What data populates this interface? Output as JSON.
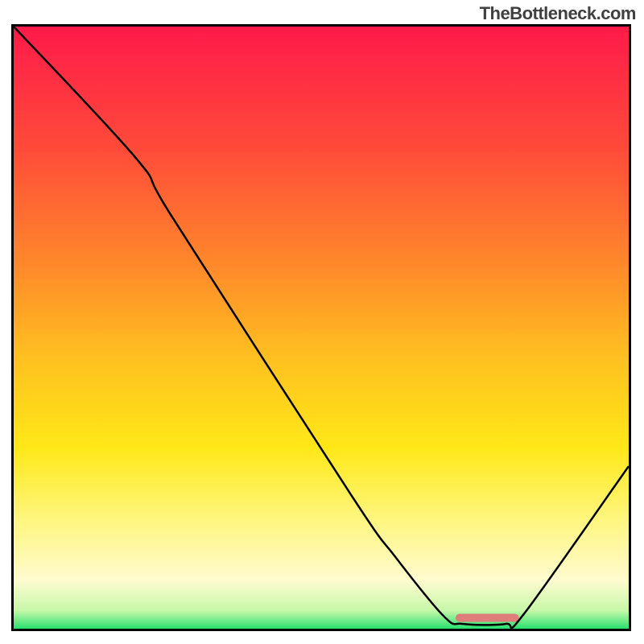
{
  "watermark": "TheBottleneck.com",
  "chart_data": {
    "type": "line",
    "title": "",
    "xlabel": "",
    "ylabel": "",
    "xlim": [
      0,
      100
    ],
    "ylim": [
      0,
      100
    ],
    "grid": false,
    "background_gradient": {
      "direction": "vertical",
      "stops": [
        {
          "offset": 0.0,
          "color": "#ff1a4a"
        },
        {
          "offset": 0.2,
          "color": "#ff4a3a"
        },
        {
          "offset": 0.4,
          "color": "#ff8a2a"
        },
        {
          "offset": 0.55,
          "color": "#ffc020"
        },
        {
          "offset": 0.7,
          "color": "#ffe818"
        },
        {
          "offset": 0.82,
          "color": "#fff680"
        },
        {
          "offset": 0.92,
          "color": "#fffbd0"
        },
        {
          "offset": 0.97,
          "color": "#c6f8a8"
        },
        {
          "offset": 1.0,
          "color": "#28e070"
        }
      ]
    },
    "curve": [
      {
        "x": 0.0,
        "y": 100.0
      },
      {
        "x": 20.0,
        "y": 78.0
      },
      {
        "x": 26.0,
        "y": 68.0
      },
      {
        "x": 55.0,
        "y": 22.0
      },
      {
        "x": 62.0,
        "y": 12.0
      },
      {
        "x": 70.0,
        "y": 2.0
      },
      {
        "x": 73.0,
        "y": 0.8
      },
      {
        "x": 80.0,
        "y": 0.8
      },
      {
        "x": 83.0,
        "y": 2.5
      },
      {
        "x": 100.0,
        "y": 27.0
      }
    ],
    "marker": {
      "x_start": 72.5,
      "x_end": 81.5,
      "y": 1.8,
      "color": "#df7d7a",
      "thickness_px": 10,
      "label": ""
    }
  }
}
